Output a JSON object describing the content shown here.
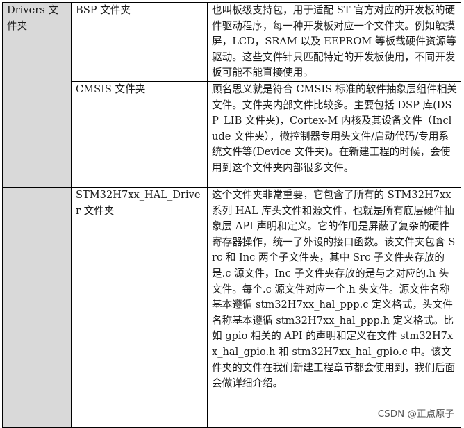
{
  "table": {
    "category": "Drivers 文件夹",
    "rows": [
      {
        "folder": "BSP 文件夹",
        "description": "也叫板级支持包，用于适配 ST 官方对应的开发板的硬件驱动程序，每一种开发板对应一个文件夹。例如触摸屏，LCD，SRAM 以及 EEPROM 等板载硬件资源等驱动。这些文件针只匹配特定的开发板使用，不同开发板可能不能直接使用。"
      },
      {
        "folder": "CMSIS 文件夹",
        "description": "顾名思义就是符合 CMSIS 标准的软件抽象层组件相关文件。文件夹内部文件比较多。主要包括 DSP 库(DSP_LIB 文件夹)，Cortex-M 内核及其设备文件（Include 文件夹），微控制器专用头文件/启动代码/专用系统文件等(Device 文件夹)。在新建工程的时候，会使用到这个文件夹内部很多文件。"
      },
      {
        "folder": "STM32H7xx_HAL_Driver 文件夹",
        "description": "这个文件夹非常重要，它包含了所有的 STM32H7xx 系列 HAL 库头文件和源文件，也就是所有底层硬件抽象层 API 声明和定义。它的作用是屏蔽了复杂的硬件寄存器操作，统一了外设的接口函数。该文件夹包含 Src 和 Inc 两个子文件夹，其中 Src 子文件夹存放的是.c 源文件，Inc 子文件夹存放的是与之对应的.h 头文件。每个.c 源文件对应一个.h 头文件。源文件名称基本遵循 stm32H7xx_hal_ppp.c 定义格式，头文件名称基本遵循 stm32H7xx_hal_ppp.h 定义格式。比如 gpio 相关的 API 的声明和定义在文件 stm32H7xx_hal_gpio.h 和 stm32H7xx_hal_gpio.c 中。该文件夹的文件在我们新建工程章节都会使用到，我们后面会做详细介绍。"
      }
    ]
  },
  "watermark": "CSDN @正点原子"
}
